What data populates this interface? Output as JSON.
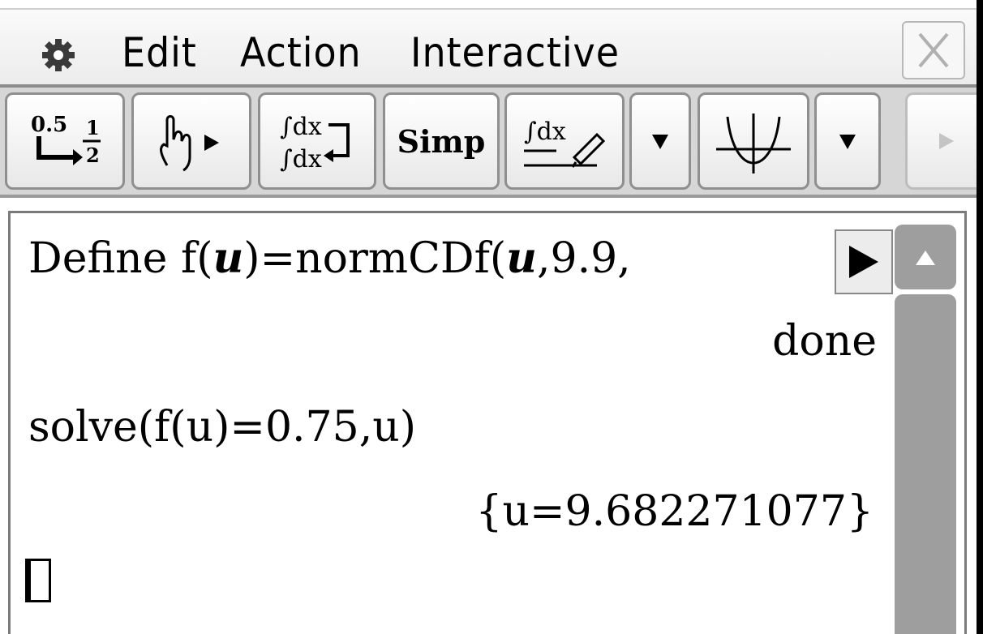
{
  "menu": {
    "items": [
      {
        "label": "Edit"
      },
      {
        "label": "Action"
      },
      {
        "label": "Interactive"
      }
    ]
  },
  "toolbar": {
    "convert_top": "0.5",
    "convert_bottom_num": "1",
    "convert_bottom_den": "2",
    "simp_label": "Simp",
    "int_label": "∫dx"
  },
  "work": {
    "line1_prefix": "Define f(",
    "line1_var": "u",
    "line1_mid": ")=normCDf(",
    "line1_var2": "u",
    "line1_suffix": ",9.9,",
    "line2": "done",
    "line3": "solve(f(u)=0.75,u)",
    "line4": "{u=9.682271077}"
  },
  "colors": {
    "menubar_bg": "#ececec",
    "toolbar_bg": "#d6d6d6",
    "scrollbar": "#9e9e9e"
  }
}
